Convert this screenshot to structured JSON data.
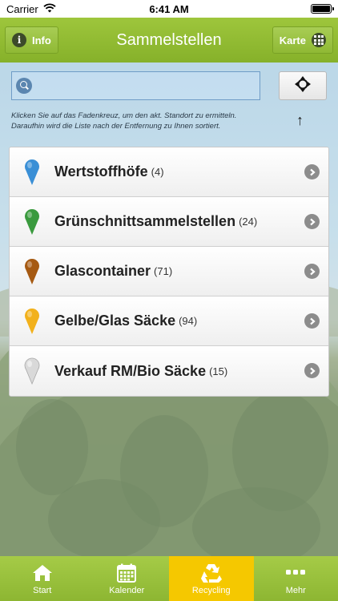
{
  "status_bar": {
    "carrier": "Carrier",
    "time": "6:41 AM"
  },
  "nav": {
    "title": "Sammelstellen",
    "left_button": "Info",
    "right_button": "Karte"
  },
  "search": {
    "value": "",
    "placeholder": ""
  },
  "hint": "Klicken Sie auf das Fadenkreuz, um den akt. Standort zu ermitteln. Daraufhin wird die Liste nach der Entfernung zu Ihnen sortiert.",
  "list": {
    "items": [
      {
        "label": "Wertstoffhöfe",
        "count": "(4)",
        "pin_color": "#3a8fd6"
      },
      {
        "label": "Grünschnittsammelstellen",
        "count": "(24)",
        "pin_color": "#3a9a3e"
      },
      {
        "label": "Glascontainer",
        "count": "(71)",
        "pin_color": "#a65a12"
      },
      {
        "label": "Gelbe/Glas Säcke",
        "count": "(94)",
        "pin_color": "#f2b11c"
      },
      {
        "label": "Verkauf RM/Bio Säcke",
        "count": "(15)",
        "pin_color": "#d9d9d9"
      }
    ]
  },
  "tabs": [
    {
      "label": "Start",
      "icon": "home-icon"
    },
    {
      "label": "Kalender",
      "icon": "calendar-icon"
    },
    {
      "label": "Recycling",
      "icon": "recycle-icon",
      "active": true
    },
    {
      "label": "Mehr",
      "icon": "more-icon"
    }
  ],
  "colors": {
    "nav_green": "#8fb935",
    "tab_active": "#f5c800"
  }
}
